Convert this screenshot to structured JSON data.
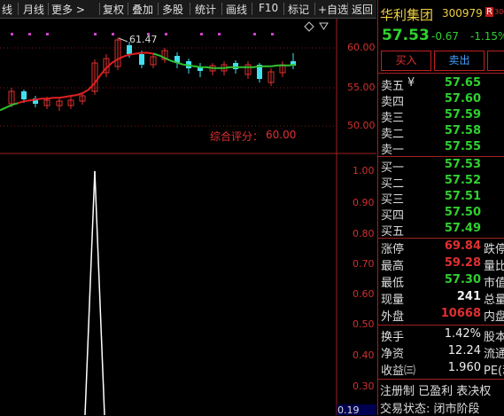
{
  "toolbar": {
    "items": [
      "线",
      "月线",
      "更多 >",
      "复权",
      "叠加",
      "多股",
      "统计",
      "画线",
      "F10",
      "标记",
      "+自选",
      "返回"
    ]
  },
  "chart": {
    "price_axis": [
      "60.00",
      "55.00",
      "50.00"
    ],
    "indicator_axis": [
      "1.00",
      "0.90",
      "0.80",
      "0.70",
      "0.60",
      "0.50",
      "0.40",
      "0.30"
    ],
    "peak_label": "61.47",
    "score_label": "综合评分：",
    "score_value": "60.00",
    "bottom_value": "0.19",
    "colors": {
      "up": "#e03030",
      "down": "#40e0f0",
      "ma_red": "#e02020",
      "ma_green": "#30c030",
      "magenta": "#d040d0"
    }
  },
  "chart_data": [
    {
      "type": "line",
      "title": "",
      "xlabel": "",
      "ylabel": "",
      "ylim": [
        47.5,
        62.5
      ],
      "x": [
        0,
        1,
        2,
        3,
        4,
        5,
        6,
        7,
        8,
        9,
        10,
        11,
        12,
        13,
        14,
        15,
        16,
        17,
        18,
        19,
        20,
        21,
        22,
        23,
        24,
        25,
        26,
        27,
        28,
        29,
        30,
        31,
        32,
        33,
        34,
        35,
        36,
        37,
        38,
        39,
        40,
        41,
        42,
        43,
        44,
        45,
        46,
        47,
        48,
        49,
        50
      ],
      "series": [
        {
          "values": [
            52.3,
            52.6,
            52.9,
            53.1,
            53.3,
            53.4,
            53.5,
            53.6,
            53.6,
            53.7,
            53.7,
            53.8,
            53.9,
            54.0,
            54.2,
            54.6,
            55.3,
            56.2,
            57.0,
            57.6,
            58.0,
            58.3,
            58.5,
            58.6,
            58.7,
            58.7,
            58.6,
            58.4,
            58.1,
            57.8,
            57.6,
            57.4,
            57.3,
            57.2,
            57.1,
            57.1,
            57.0,
            57.0,
            57.0,
            57.1,
            57.1,
            57.1,
            57.1,
            57.1,
            57.2,
            57.2,
            57.2,
            57.3,
            57.3,
            57.3,
            57.4
          ]
        }
      ]
    },
    {
      "type": "line",
      "title": "",
      "xlabel": "",
      "ylabel": "",
      "ylim": [
        0.19,
        1.05
      ],
      "x": [
        0,
        1,
        2
      ],
      "series": [
        {
          "values": [
            0.19,
            1.0,
            0.19
          ]
        }
      ]
    }
  ],
  "panel": {
    "name": "华利集团",
    "code": "300979",
    "tag": "R",
    "tag2": "300",
    "price": "57.53",
    "change": "-0.67",
    "change_pct": "-1.15%",
    "buy_btn": "买入",
    "sell_btn": "卖出",
    "extra_btn": "",
    "asks": [
      {
        "label": "卖五",
        "mark": "¥",
        "value": "57.65"
      },
      {
        "label": "卖四",
        "mark": "",
        "value": "57.60"
      },
      {
        "label": "卖三",
        "mark": "",
        "value": "57.59"
      },
      {
        "label": "卖二",
        "mark": "",
        "value": "57.58"
      },
      {
        "label": "卖一",
        "mark": "",
        "value": "57.55"
      }
    ],
    "bids": [
      {
        "label": "买一",
        "value": "57.53"
      },
      {
        "label": "买二",
        "value": "57.52"
      },
      {
        "label": "买三",
        "value": "57.51"
      },
      {
        "label": "买四",
        "value": "57.50"
      },
      {
        "label": "买五",
        "value": "57.49"
      }
    ],
    "stats": [
      {
        "label": "涨停",
        "value": "69.84",
        "extra": "跌停",
        "color": "#e03030"
      },
      {
        "label": "最高",
        "value": "59.28",
        "extra": "量比",
        "color": "#e03030"
      },
      {
        "label": "最低",
        "value": "57.30",
        "extra": "市值",
        "color": "#30d030"
      },
      {
        "label": "现量",
        "value": "241",
        "extra": "总量",
        "color": "#eeeeee"
      },
      {
        "label": "外盘",
        "value": "10668",
        "extra": "内盘",
        "color": "#e03030"
      }
    ],
    "fin": [
      {
        "label": "换手",
        "value": "1.42%",
        "extra": "股本"
      },
      {
        "label": "净资",
        "value": "12.24",
        "extra": "流通"
      },
      {
        "label": "收益㈢",
        "value": "1.960",
        "extra": "PE(动"
      }
    ],
    "footer1": "注册制  已盈利  表决权",
    "footer2": "交易状态: 闭市阶段"
  }
}
